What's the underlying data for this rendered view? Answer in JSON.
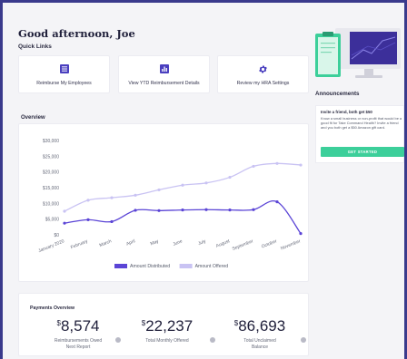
{
  "greeting": "Good afternoon, Joe",
  "quick_links": {
    "title": "Quick Links",
    "items": [
      {
        "label": "Reimburse My Employees",
        "icon": "list-icon"
      },
      {
        "label": "View YTD Reimbursement Details",
        "icon": "bar-chart-icon"
      },
      {
        "label": "Review my HRA Settings",
        "icon": "gear-icon"
      }
    ]
  },
  "overview": {
    "title": "Overview"
  },
  "chart_data": {
    "type": "line",
    "categories": [
      "January 2020",
      "February",
      "March",
      "April",
      "May",
      "June",
      "July",
      "August",
      "September",
      "October",
      "November"
    ],
    "series": [
      {
        "name": "Amount Distributed",
        "color": "#5b45d6",
        "values": [
          3700,
          4800,
          4200,
          7800,
          7700,
          7900,
          8000,
          7900,
          8000,
          10500,
          400
        ]
      },
      {
        "name": "Amount Offered",
        "color": "#c9c3f3",
        "values": [
          7500,
          11000,
          11800,
          12600,
          14300,
          15800,
          16500,
          18300,
          21800,
          22700,
          22200
        ]
      }
    ],
    "yticks": [
      "$0",
      "$5,000",
      "$10,000",
      "$15,000",
      "$20,000",
      "$25,000",
      "$30,000"
    ],
    "ylim": [
      0,
      30000
    ],
    "grid": false,
    "legend": "bottom"
  },
  "payments": {
    "title": "Payments Overview",
    "stats": [
      {
        "value": "8,574",
        "currency": "$",
        "label": "Reimbursements Owed Next Report"
      },
      {
        "value": "22,237",
        "currency": "$",
        "label": "Total Monthly Offered"
      },
      {
        "value": "86,693",
        "currency": "$",
        "label": "Total Unclaimed Balance"
      }
    ]
  },
  "announcements": {
    "title": "Announcements",
    "headline": "Invite a friend, both get $50",
    "body": "Know a small business or non-profit that would be a good fit for Take Command Health? Invite a friend and you both get a $50 Amazon gift card.",
    "button": "GET STARTED"
  }
}
